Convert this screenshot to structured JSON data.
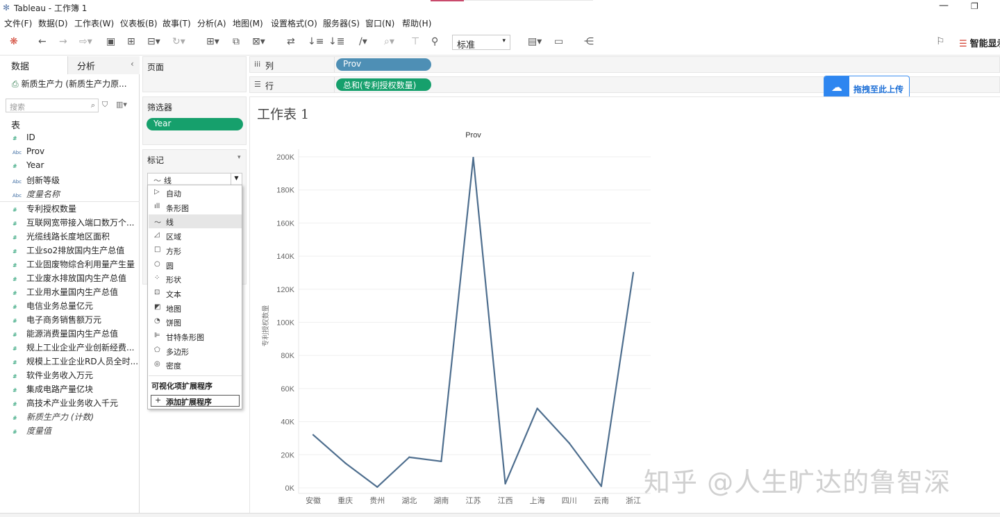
{
  "window": {
    "title": "Tableau - 工作簿 1"
  },
  "menu": [
    "文件(F)",
    "数据(D)",
    "工作表(W)",
    "仪表板(B)",
    "故事(T)",
    "分析(A)",
    "地图(M)",
    "设置格式(O)",
    "服务器(S)",
    "窗口(N)",
    "帮助(H)"
  ],
  "toolbar": {
    "fit_value": "标准",
    "smart_label": "智能显示"
  },
  "left": {
    "tab_data": "数据",
    "tab_analysis": "分析",
    "datasource": "新质生产力 (新质生产力原...",
    "search_placeholder": "搜索",
    "section_table": "表",
    "dimensions": [
      {
        "type": "#",
        "name": "ID"
      },
      {
        "type": "Abc",
        "name": "Prov"
      },
      {
        "type": "#",
        "name": "Year"
      },
      {
        "type": "Abc",
        "name": "创新等级"
      },
      {
        "type": "Abc",
        "name": "度量名称",
        "italic": true
      }
    ],
    "measures": [
      {
        "type": "#",
        "name": "专利授权数量"
      },
      {
        "type": "#",
        "name": "互联网宽带接入端口数万个..."
      },
      {
        "type": "#",
        "name": "光缆线路长度地区面积"
      },
      {
        "type": "#",
        "name": "工业so2排放国内生产总值"
      },
      {
        "type": "#",
        "name": "工业固废物综合利用量产生量"
      },
      {
        "type": "#",
        "name": "工业废水排放国内生产总值"
      },
      {
        "type": "#",
        "name": "工业用水量国内生产总值"
      },
      {
        "type": "#",
        "name": "电信业务总量亿元"
      },
      {
        "type": "#",
        "name": "电子商务销售额万元"
      },
      {
        "type": "#",
        "name": "能源消费量国内生产总值"
      },
      {
        "type": "#",
        "name": "规上工业企业产业创新经费..."
      },
      {
        "type": "#",
        "name": "规模上工业企业RD人员全时..."
      },
      {
        "type": "#",
        "name": "软件业务收入万元"
      },
      {
        "type": "#",
        "name": "集成电路产量亿块"
      },
      {
        "type": "#",
        "name": "高技术产业业务收入千元"
      },
      {
        "type": "#",
        "name": "新质生产力 (计数)",
        "italic": true
      },
      {
        "type": "#",
        "name": "度量值",
        "italic": true
      }
    ]
  },
  "cards": {
    "pages": "页面",
    "filters": "筛选器",
    "filter_pill": "Year",
    "marks": "标记",
    "mark_type": "线"
  },
  "mark_menu": {
    "items": [
      {
        "icon": "▷",
        "label": "自动"
      },
      {
        "icon": "ıll",
        "label": "条形图"
      },
      {
        "icon": "〜",
        "label": "线",
        "selected": true
      },
      {
        "icon": "◿",
        "label": "区域"
      },
      {
        "icon": "□",
        "label": "方形"
      },
      {
        "icon": "○",
        "label": "圆"
      },
      {
        "icon": "⁘",
        "label": "形状"
      },
      {
        "icon": "⊡",
        "label": "文本"
      },
      {
        "icon": "◩",
        "label": "地图"
      },
      {
        "icon": "◔",
        "label": "饼图"
      },
      {
        "icon": "⊫",
        "label": "甘特条形图"
      },
      {
        "icon": "⬠",
        "label": "多边形"
      },
      {
        "icon": "◎",
        "label": "密度"
      }
    ],
    "ext_header": "可视化项扩展程序",
    "add_ext": "添加扩展程序"
  },
  "shelves": {
    "columns_label": "列",
    "columns_pill": "Prov",
    "rows_label": "行",
    "rows_pill": "总和(专利授权数量)"
  },
  "upload_label": "拖拽至此上传",
  "sheet_title": "工作表 1",
  "chart_data": {
    "type": "line",
    "title": "Prov",
    "xlabel": "",
    "ylabel": "专利授权数量",
    "categories": [
      "安徽",
      "重庆",
      "贵州",
      "湖北",
      "湖南",
      "江苏",
      "江西",
      "上海",
      "四川",
      "云南",
      "浙江"
    ],
    "values": [
      32000,
      15000,
      500,
      18500,
      16000,
      199500,
      2500,
      48000,
      27000,
      1000,
      130000
    ],
    "ylim": [
      0,
      210000
    ],
    "yticks": [
      0,
      20000,
      40000,
      60000,
      80000,
      100000,
      120000,
      140000,
      160000,
      180000,
      200000
    ],
    "ytick_labels": [
      "0K",
      "20K",
      "40K",
      "60K",
      "80K",
      "100K",
      "120K",
      "140K",
      "160K",
      "180K",
      "200K"
    ],
    "line_color": "#4e6e8e",
    "grid": true
  },
  "watermark": "知乎 @人生旷达的鲁智深"
}
